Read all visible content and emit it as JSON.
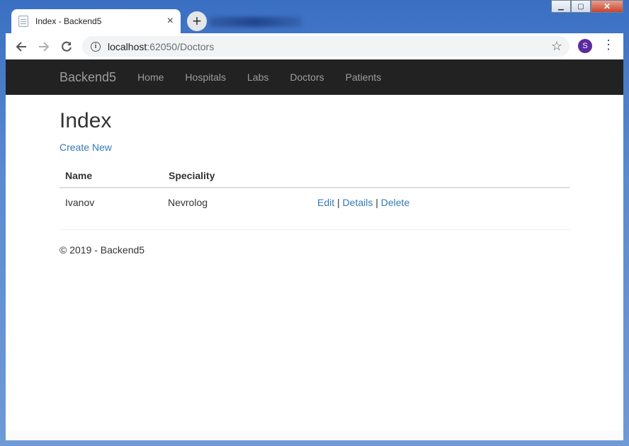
{
  "browser": {
    "tab_title": "Index - Backend5",
    "tab_close": "×",
    "new_tab": "+",
    "url_host": "localhost",
    "url_rest": ":62050/Doctors",
    "profile_initial": "S"
  },
  "window": {
    "minimize": "▭",
    "restore": "▢",
    "close": "✕"
  },
  "navbar": {
    "brand": "Backend5",
    "links": [
      "Home",
      "Hospitals",
      "Labs",
      "Doctors",
      "Patients"
    ]
  },
  "page": {
    "title": "Index",
    "create_link": "Create New",
    "table": {
      "headers": [
        "Name",
        "Speciality",
        ""
      ],
      "rows": [
        {
          "name": "Ivanov",
          "speciality": "Nevrolog",
          "edit": "Edit",
          "details": "Details",
          "delete": "Delete",
          "sep": "|"
        }
      ]
    },
    "footer": "© 2019 - Backend5"
  },
  "colors": {
    "navbar_bg": "#222222",
    "link": "#337ab7",
    "nav_text": "#9d9d9d"
  }
}
